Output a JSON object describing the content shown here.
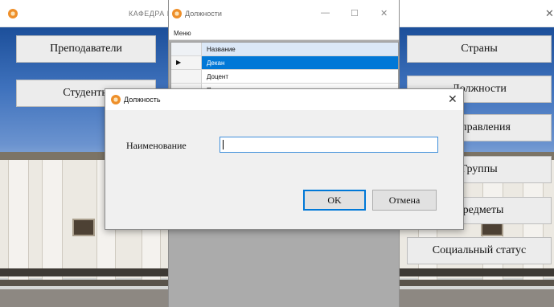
{
  "main_window": {
    "title": "КАФЕДРА И",
    "close_glyph": "✕",
    "left_buttons": [
      "Преподаватели",
      "Студенты"
    ],
    "right_buttons": [
      "Страны",
      "Должности",
      "Направления",
      "Группы",
      "Предметы",
      "Социальный статус"
    ]
  },
  "list_window": {
    "title": "Должности",
    "controls": {
      "minimize": "—",
      "maximize": "☐",
      "close": "✕"
    },
    "menu": "Меню",
    "grid": {
      "header": "Название",
      "rows": [
        "Декан",
        "Доцент",
        "П"
      ],
      "selected_row_pointer": "▶"
    }
  },
  "dialog": {
    "title": "Должность",
    "close_glyph": "✕",
    "field_label": "Наименование",
    "field_value": "",
    "ok_label": "OK",
    "cancel_label": "Отмена"
  },
  "icons": {
    "app_icon": "app-icon",
    "accent": "#0078d7",
    "icon_orange": "#ee8f2a"
  }
}
